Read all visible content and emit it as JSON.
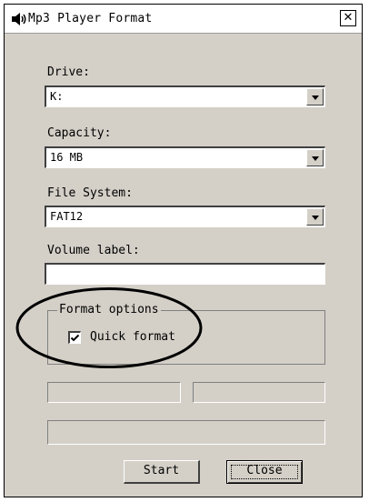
{
  "window": {
    "title": "Mp3 Player Format",
    "icon": "speaker-icon",
    "close_glyph": "✕"
  },
  "fields": {
    "drive_label": "Drive:",
    "drive_value": "K:",
    "capacity_label": "Capacity:",
    "capacity_value": "16 MB",
    "filesystem_label": "File System:",
    "filesystem_value": "FAT12",
    "volume_label": "Volume label:",
    "volume_value": ""
  },
  "format_options": {
    "title": "Format options",
    "quick_format_label": "Quick format",
    "quick_format_checked": true
  },
  "buttons": {
    "start_label": "Start",
    "close_label": "Close"
  },
  "annotation": {
    "shape": "ellipse",
    "color": "#000000"
  }
}
